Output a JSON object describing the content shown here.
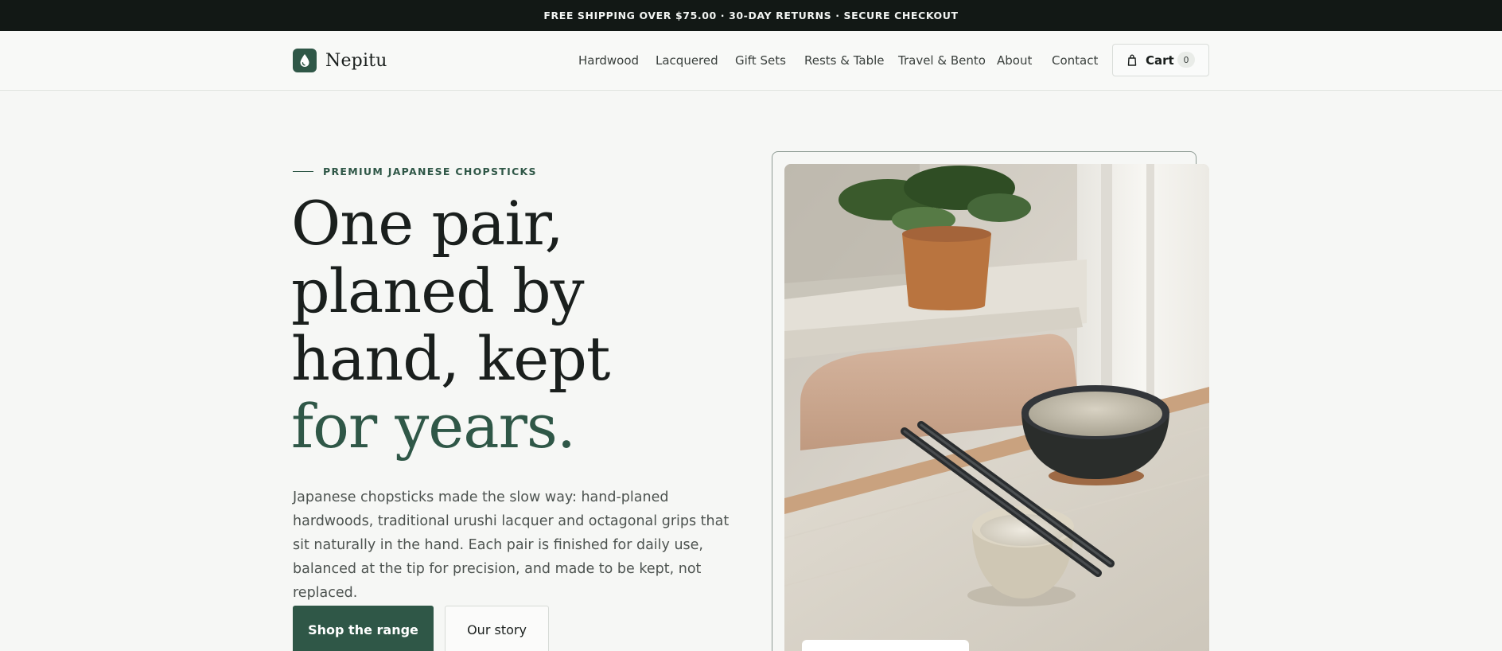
{
  "announcement": "FREE SHIPPING OVER $75.00 · 30-DAY RETURNS · SECURE CHECKOUT",
  "brand": {
    "name": "Nepitu",
    "accent_color": "#2f5747"
  },
  "nav": {
    "items": [
      "Hardwood",
      "Lacquered",
      "Gift Sets",
      "Rests & Table",
      "Travel & Bento",
      "About",
      "Contact"
    ]
  },
  "cart": {
    "label": "Cart",
    "count": "0",
    "icon": "bag-icon"
  },
  "hero": {
    "eyebrow": "PREMIUM JAPANESE CHOPSTICKS",
    "headline_lines": [
      "One pair,",
      "planed by",
      "hand, kept"
    ],
    "headline_accent": "for years.",
    "lead": "Japanese chopsticks made the slow way: hand-planed hardwoods, traditional urushi lacquer and octagonal grips that sit naturally in the hand. Each pair is finished for daily use, balanced at the tip for precision, and made to be kept, not replaced.",
    "primary_cta": "Shop the range",
    "secondary_cta": "Our story"
  }
}
